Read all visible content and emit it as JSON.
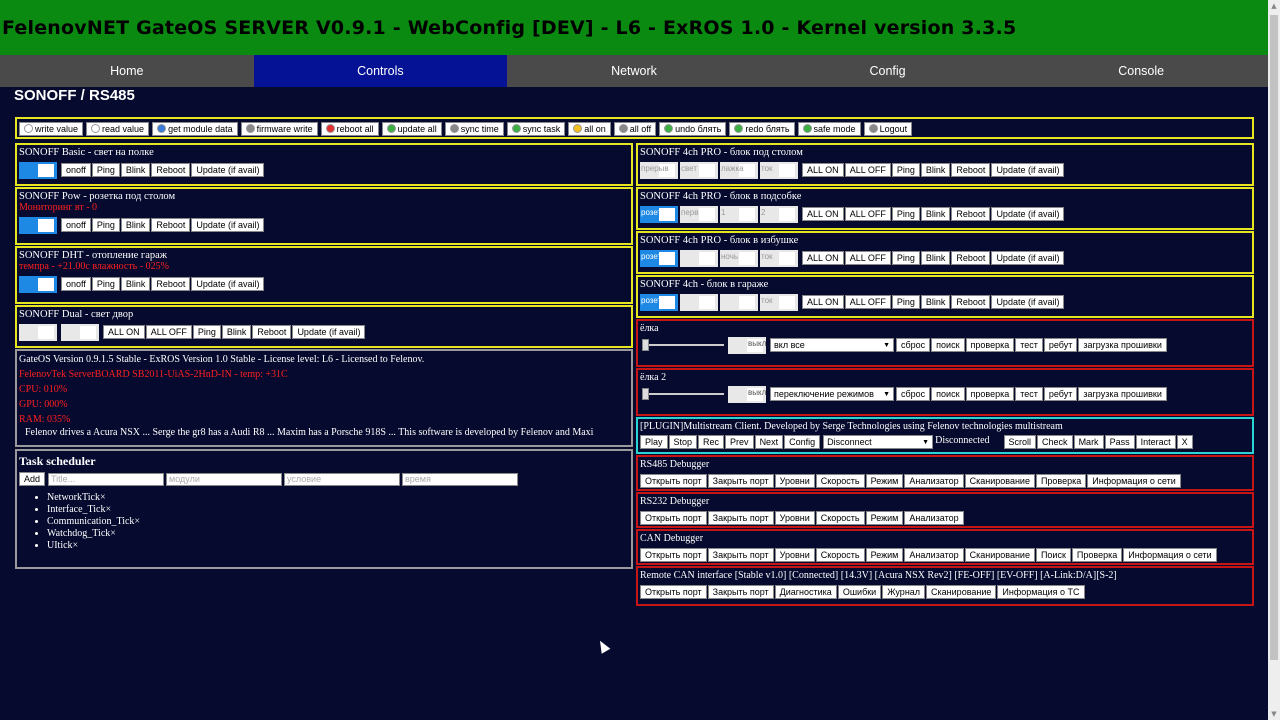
{
  "header": {
    "title": "FelenovNET GateOS SERVER V0.9.1 - WebConfig [DEV] - L6 - ExROS 1.0 - Kernel version 3.3.5"
  },
  "nav": [
    {
      "label": "Home"
    },
    {
      "label": "Controls"
    },
    {
      "label": "Network"
    },
    {
      "label": "Config"
    },
    {
      "label": "Console"
    }
  ],
  "page_title": "SONOFF / RS485",
  "toolbar": [
    {
      "label": "write value",
      "icon": "doc-icon",
      "color": "#ffffff"
    },
    {
      "label": "read value",
      "icon": "doc-icon",
      "color": "#ffffff"
    },
    {
      "label": "get module data",
      "icon": "info-icon",
      "color": "#3a7bd5"
    },
    {
      "label": "firmware write",
      "icon": "gear-icon",
      "color": "#888888"
    },
    {
      "label": "reboot all",
      "icon": "power-icon",
      "color": "#e03030"
    },
    {
      "label": "update all",
      "icon": "download-icon",
      "color": "#3cb043"
    },
    {
      "label": "sync time",
      "icon": "clock-icon",
      "color": "#888888"
    },
    {
      "label": "sync task",
      "icon": "sync-icon",
      "color": "#3cb043"
    },
    {
      "label": "all on",
      "icon": "bulb-on-icon",
      "color": "#f0c020"
    },
    {
      "label": "all off",
      "icon": "bulb-off-icon",
      "color": "#888888"
    },
    {
      "label": "undo блять",
      "icon": "undo-icon",
      "color": "#3cb043"
    },
    {
      "label": "redo блять",
      "icon": "redo-icon",
      "color": "#3cb043"
    },
    {
      "label": "safe mode",
      "icon": "pencil-icon",
      "color": "#3cb043"
    },
    {
      "label": "Logout",
      "icon": "logout-icon",
      "color": "#888888"
    }
  ],
  "left": {
    "basic": {
      "title": "SONOFF Basic - свет на полке",
      "buttons": [
        "onoff",
        "Ping",
        "Blink",
        "Reboot",
        "Update (if avail)"
      ]
    },
    "pow": {
      "title": "SONOFF Pow - розетка под столом",
      "status": "Мониторинг вт - 0",
      "buttons": [
        "onoff",
        "Ping",
        "Blink",
        "Reboot",
        "Update (if avail)"
      ]
    },
    "dht": {
      "title": "SONOFF DHT - отопление гараж",
      "status": "темпра - +21.00с влажность - 025%",
      "buttons": [
        "onoff",
        "Ping",
        "Blink",
        "Reboot",
        "Update (if avail)"
      ]
    },
    "dual": {
      "title": "SONOFF Dual - свет двор",
      "buttons": [
        "ALL ON",
        "ALL OFF",
        "Ping",
        "Blink",
        "Reboot",
        "Update (if avail)"
      ]
    },
    "info": {
      "version": "GateOS Version 0.9.1.5 Stable - ExROS Version 1.0 Stable - License level: L6 - Licensed to Felenov.",
      "board": "FelenovTek ServerBOARD SB2011-UiAS-2HnD-IN - temp: +31C",
      "cpu": "CPU: 010%",
      "gpu": "GPU: 000%",
      "ram": "RAM: 035%",
      "marquee": "Felenov drives a Acura NSX ... Serge the gr8 has a Audi R8 ... Maxim has a Porsche 918S ... This software is developed by Felenov and Maxi"
    },
    "scheduler": {
      "title": "Task scheduler",
      "add": "Add",
      "ph_title": "Title...",
      "ph_modules": "модули",
      "ph_condition": "условие",
      "ph_time": "время",
      "tasks": [
        "NetworkTick×",
        "Interface_Tick×",
        "Communication_Tick×",
        "Watchdog_Tick×",
        "UItick×"
      ]
    }
  },
  "right": {
    "pro1": {
      "title": "SONOFF 4ch PRO - блок под столом",
      "switches": [
        "прерыв",
        "свет",
        "лажка",
        "ток"
      ],
      "buttons": [
        "ALL ON",
        "ALL OFF",
        "Ping",
        "Blink",
        "Reboot",
        "Update (if avail)"
      ]
    },
    "pro2": {
      "title": "SONOFF 4ch PRO - блок в подсобке",
      "switches": [
        "розет",
        "перв",
        "1",
        "2"
      ],
      "buttons": [
        "ALL ON",
        "ALL OFF",
        "Ping",
        "Blink",
        "Reboot",
        "Update (if avail)"
      ]
    },
    "pro3": {
      "title": "SONOFF 4ch PRO - блок в избушке",
      "switches": [
        "розет",
        "",
        "ночь",
        "ток"
      ],
      "buttons": [
        "ALL ON",
        "ALL OFF",
        "Ping",
        "Blink",
        "Reboot",
        "Update (if avail)"
      ]
    },
    "ch4": {
      "title": "SONOFF 4ch - блок в гараже",
      "switches": [
        "розет",
        "",
        "",
        "ток"
      ],
      "buttons": [
        "ALL ON",
        "ALL OFF",
        "Ping",
        "Blink",
        "Reboot",
        "Update (if avail)"
      ]
    },
    "elka1": {
      "title": "ёлка",
      "toggle": "выкл",
      "select": "вкл все",
      "buttons": [
        "сброс",
        "поиск",
        "проверка",
        "тест",
        "ребут",
        "загрузка прошивки"
      ]
    },
    "elka2": {
      "title": "ёлка 2",
      "toggle": "выкл",
      "select": "переключение режимов",
      "buttons": [
        "сброс",
        "поиск",
        "проверка",
        "тест",
        "ребут",
        "загрузка прошивки"
      ]
    },
    "plugin": {
      "title": "[PLUGIN]Multistream Client. Developed by Serge Technologies using Felenov technologies multistream",
      "buttons": [
        "Play",
        "Stop",
        "Rec",
        "Prev",
        "Next",
        "Config"
      ],
      "select": "Disconnect",
      "status": "Disconnected",
      "right_buttons": [
        "Scroll",
        "Check",
        "Mark",
        "Pass",
        "Interact",
        "X"
      ]
    },
    "rs485": {
      "title": "RS485 Debugger",
      "buttons": [
        "Открыть порт",
        "Закрыть порт",
        "Уровни",
        "Скорость",
        "Режим",
        "Анализатор",
        "Сканирование",
        "Проверка",
        "Информация о сети"
      ]
    },
    "rs232": {
      "title": "RS232 Debugger",
      "buttons": [
        "Открыть порт",
        "Закрыть порт",
        "Уровни",
        "Скорость",
        "Режим",
        "Анализатор"
      ]
    },
    "can": {
      "title": "CAN Debugger",
      "buttons": [
        "Открыть порт",
        "Закрыть порт",
        "Уровни",
        "Скорость",
        "Режим",
        "Анализатор",
        "Сканирование",
        "Поиск",
        "Проверка",
        "Информация о сети"
      ]
    },
    "remote": {
      "title": "Remote CAN interface [Stable v1.0] [Connected] [14.3V] [Acura NSX Rev2] [FE-OFF] [EV-OFF] [A-Link:D/A][S-2]",
      "buttons": [
        "Открыть порт",
        "Закрыть порт",
        "Диагностика",
        "Ошибки",
        "Журнал",
        "Сканирование",
        "Информация о ТС"
      ]
    }
  }
}
